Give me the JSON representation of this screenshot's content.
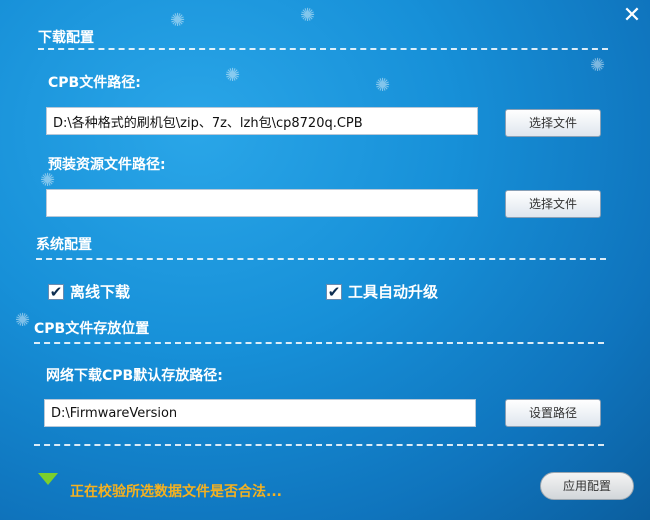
{
  "window": {
    "close_glyph": "✕"
  },
  "download_config": {
    "title": "下载配置",
    "cpb_label": "CPB文件路径:",
    "cpb_path": "D:\\各种格式的刷机包\\zip、7z、lzh包\\cp8720q.CPB",
    "cpb_button": "选择文件",
    "preinstall_label": "预装资源文件路径:",
    "preinstall_path": "",
    "preinstall_button": "选择文件"
  },
  "system_config": {
    "title": "系统配置",
    "offline_download": {
      "label": "离线下载",
      "checked": true
    },
    "auto_upgrade": {
      "label": "工具自动升级",
      "checked": true
    }
  },
  "cpb_storage": {
    "title": "CPB文件存放位置",
    "network_label": "网络下载CPB默认存放路径:",
    "path": "D:\\FirmwareVersion",
    "button": "设置路径"
  },
  "footer": {
    "status_text": "正在校验所选数据文件是否合法...",
    "apply_button": "应用配置",
    "status_color": "#f5b120",
    "icon": "green-down-arrow-icon"
  }
}
